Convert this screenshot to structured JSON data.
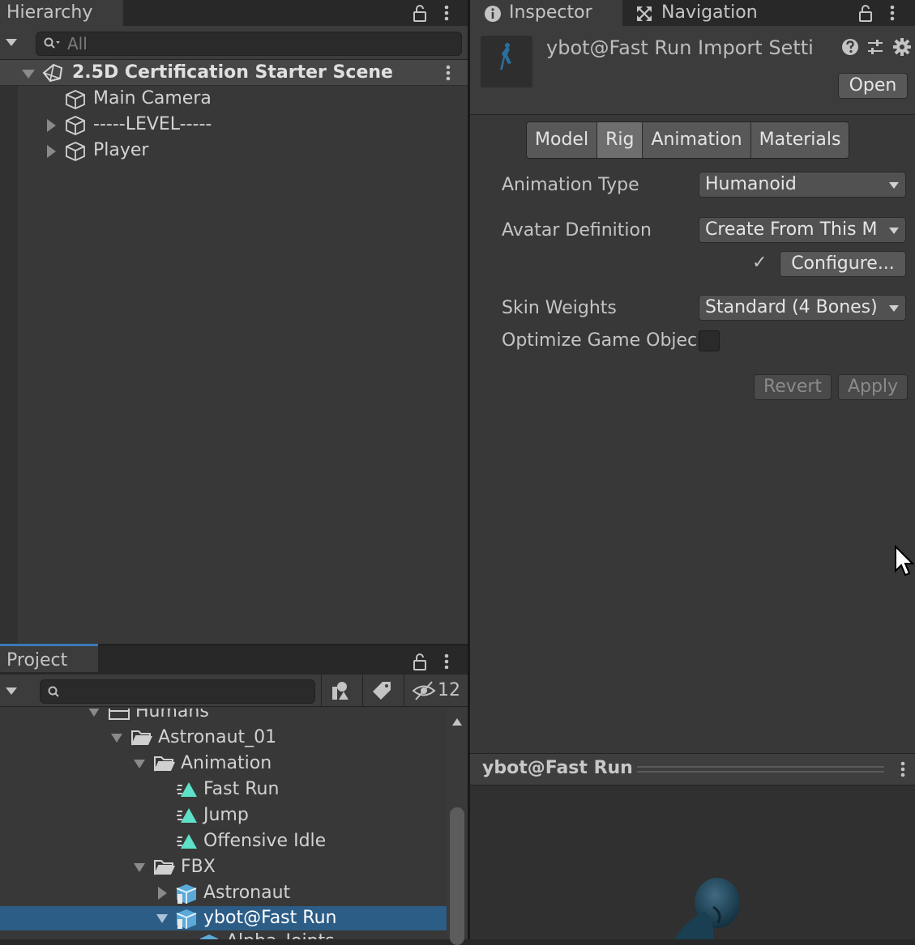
{
  "hierarchy": {
    "title": "Hierarchy",
    "search_placeholder": "All",
    "scene_name": "2.5D Certification Starter Scene",
    "items": [
      {
        "label": "Main Camera"
      },
      {
        "label": "-----LEVEL-----"
      },
      {
        "label": "Player"
      }
    ]
  },
  "project": {
    "title": "Project",
    "hidden_count": "12",
    "tree": [
      {
        "label": "Humans"
      },
      {
        "label": "Astronaut_01"
      },
      {
        "label": "Animation"
      },
      {
        "label": "Fast Run"
      },
      {
        "label": "Jump"
      },
      {
        "label": "Offensive Idle"
      },
      {
        "label": "FBX"
      },
      {
        "label": "Astronaut"
      },
      {
        "label": "ybot@Fast Run"
      },
      {
        "label": "Alpha_Joints"
      }
    ]
  },
  "inspector": {
    "tab_inspector": "Inspector",
    "tab_navigation": "Navigation",
    "asset_title": "ybot@Fast Run Import Setti",
    "open_label": "Open",
    "tabs": [
      "Model",
      "Rig",
      "Animation",
      "Materials"
    ],
    "active_tab": "Rig",
    "fields": {
      "animation_type_label": "Animation Type",
      "animation_type_value": "Humanoid",
      "avatar_definition_label": "Avatar Definition",
      "avatar_definition_value": "Create From This M",
      "configure_label": "Configure...",
      "configure_check": "✓",
      "skin_weights_label": "Skin Weights",
      "skin_weights_value": "Standard (4 Bones)",
      "optimize_label": "Optimize Game Objec"
    },
    "revert_label": "Revert",
    "apply_label": "Apply"
  },
  "preview": {
    "title": "ybot@Fast Run"
  },
  "colors": {
    "selection": "#2c5d87",
    "animation_clip_icon": "#5fe0c8",
    "prefab_icon": "#5aa9d8"
  }
}
